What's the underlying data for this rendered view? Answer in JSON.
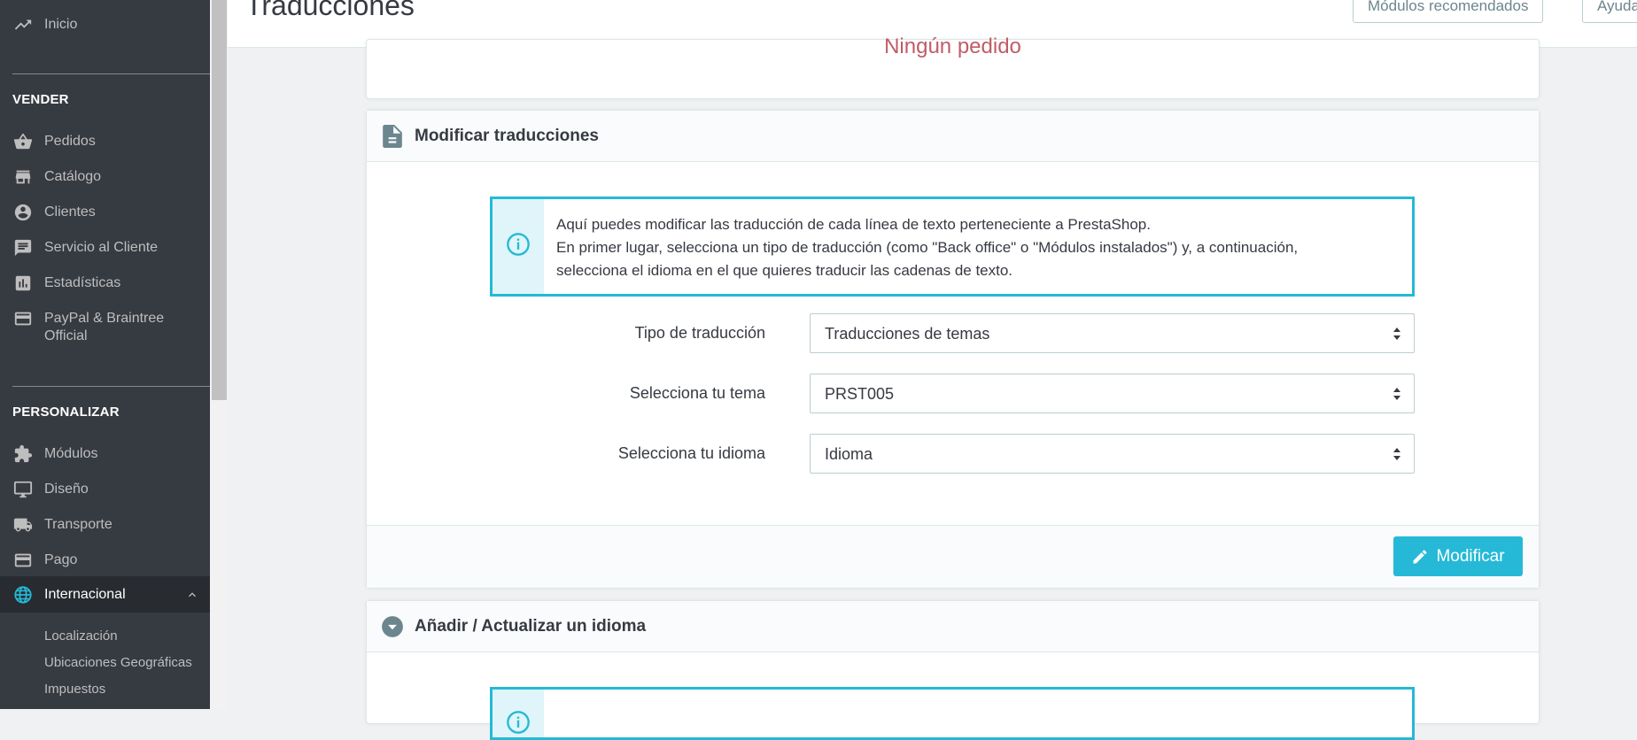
{
  "sidebar": {
    "top_item": {
      "label": "Inicio",
      "icon": "trending-up-icon"
    },
    "sections": [
      {
        "title": "VENDER"
      },
      {
        "title": "PERSONALIZAR"
      }
    ],
    "sell_items": [
      {
        "label": "Pedidos",
        "icon": "shopping-basket-icon"
      },
      {
        "label": "Catálogo",
        "icon": "store-icon"
      },
      {
        "label": "Clientes",
        "icon": "account-circle-icon"
      },
      {
        "label": "Servicio al Cliente",
        "icon": "chat-icon"
      },
      {
        "label": "Estadísticas",
        "icon": "bar-chart-icon"
      },
      {
        "label": "PayPal & Braintree",
        "label2": "Official",
        "icon": "credit-card-icon"
      }
    ],
    "customize_items": [
      {
        "label": "Módulos",
        "icon": "puzzle-icon"
      },
      {
        "label": "Diseño",
        "icon": "desktop-icon"
      },
      {
        "label": "Transporte",
        "icon": "truck-icon"
      },
      {
        "label": "Pago",
        "icon": "credit-card-icon"
      },
      {
        "label": "Internacional",
        "icon": "globe-icon",
        "active": true
      }
    ],
    "sub_items": [
      "Localización",
      "Ubicaciones Geográficas",
      "Impuestos"
    ]
  },
  "header": {
    "title": "Traducciones",
    "buttons": [
      "Módulos recomendados",
      "Ayuda"
    ]
  },
  "top_panel": {
    "message": "Ningún pedido"
  },
  "translations_panel": {
    "title": "Modificar traducciones",
    "info_lines": [
      "Aquí puedes modificar las traducción de cada línea de texto perteneciente a PrestaShop.",
      "En primer lugar, selecciona un tipo de traducción (como \"Back office\" o \"Módulos instalados\") y, a continuación,",
      "selecciona el idioma en el que quieres traducir las cadenas de texto."
    ],
    "fields": [
      {
        "label": "Tipo de traducción",
        "value": "Traducciones de temas"
      },
      {
        "label": "Selecciona tu tema",
        "value": "PRST005"
      },
      {
        "label": "Selecciona tu idioma",
        "value": "Idioma"
      }
    ],
    "submit_label": "Modificar"
  },
  "language_panel": {
    "title": "Añadir / Actualizar un idioma"
  },
  "colors": {
    "accent": "#25b9d7",
    "sidebar_bg": "#363a41",
    "danger_text": "#c05c67"
  }
}
